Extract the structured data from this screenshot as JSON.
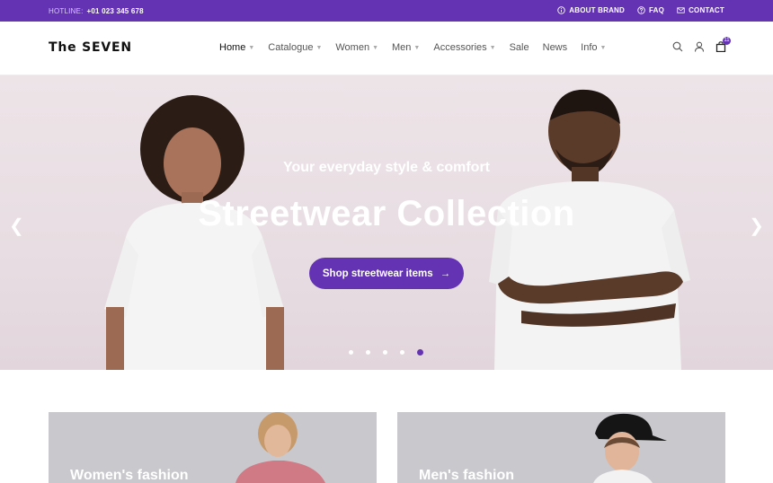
{
  "topbar": {
    "hotline_label": "HOTLINE:",
    "hotline_number": "+01 023 345 678",
    "links": [
      {
        "label": "ABOUT BRAND",
        "icon": "info-icon"
      },
      {
        "label": "FAQ",
        "icon": "help-icon"
      },
      {
        "label": "CONTACT",
        "icon": "mail-icon"
      }
    ]
  },
  "header": {
    "logo": "The SEVEN",
    "nav": [
      {
        "label": "Home",
        "dropdown": true
      },
      {
        "label": "Catalogue",
        "dropdown": true
      },
      {
        "label": "Women",
        "dropdown": true
      },
      {
        "label": "Men",
        "dropdown": true
      },
      {
        "label": "Accessories",
        "dropdown": true
      },
      {
        "label": "Sale",
        "dropdown": false
      },
      {
        "label": "News",
        "dropdown": false
      },
      {
        "label": "Info",
        "dropdown": true
      }
    ],
    "cart_count": "11"
  },
  "hero": {
    "tagline": "Your everyday style & comfort",
    "headline": "Streetwear Collection",
    "cta_label": "Shop streetwear items",
    "slides": 5,
    "active_slide": 5
  },
  "categories": [
    {
      "title": "Women's fashion"
    },
    {
      "title": "Men's fashion"
    }
  ],
  "colors": {
    "accent": "#6433b4",
    "hero_bg": "#ede4e8"
  }
}
